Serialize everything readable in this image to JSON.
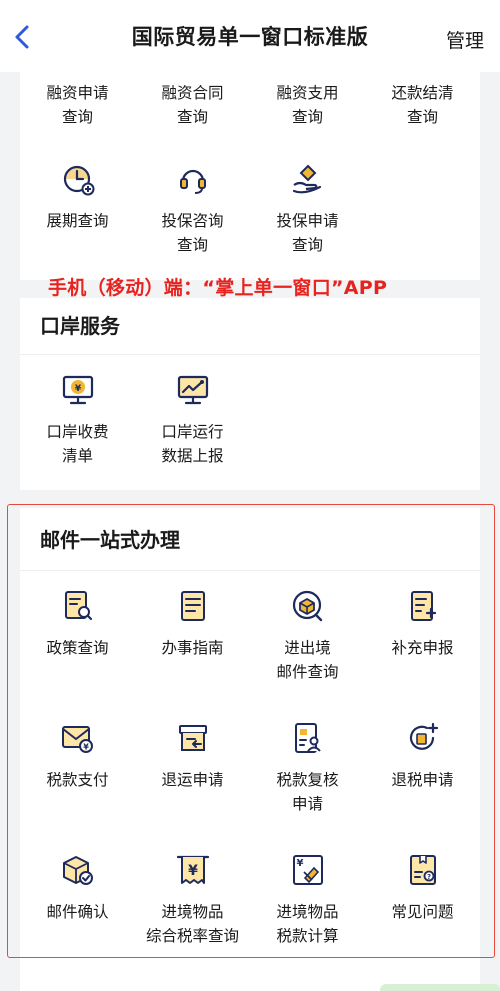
{
  "nav": {
    "title": "国际贸易单一窗口标准版",
    "manage_label": "管理"
  },
  "annotation": "手机（移动）端：“掌上单一窗口”APP",
  "finance": {
    "items": [
      {
        "label": "融资申请\n查询"
      },
      {
        "label": "融资合同\n查询"
      },
      {
        "label": "融资支用\n查询"
      },
      {
        "label": "还款结清\n查询"
      },
      {
        "label": "展期查询",
        "icon": "clock-plus-icon"
      },
      {
        "label": "投保咨询\n查询",
        "icon": "headset-icon"
      },
      {
        "label": "投保申请\n查询",
        "icon": "hand-diamond-icon"
      }
    ]
  },
  "port": {
    "title": "口岸服务",
    "items": [
      {
        "label": "口岸收费\n清单",
        "icon": "yuan-monitor-icon"
      },
      {
        "label": "口岸运行\n数据上报",
        "icon": "trend-monitor-icon"
      }
    ]
  },
  "mail": {
    "title": "邮件一站式办理",
    "items": [
      {
        "label": "政策查询",
        "icon": "document-search-icon"
      },
      {
        "label": "办事指南",
        "icon": "guide-document-icon"
      },
      {
        "label": "进出境\n邮件查询",
        "icon": "package-search-icon"
      },
      {
        "label": "补充申报",
        "icon": "document-add-icon"
      },
      {
        "label": "税款支付",
        "icon": "envelope-yuan-icon"
      },
      {
        "label": "退运申请",
        "icon": "return-box-icon"
      },
      {
        "label": "税款复核\n申请",
        "icon": "document-user-icon"
      },
      {
        "label": "退税申请",
        "icon": "tax-refund-icon"
      },
      {
        "label": "邮件确认",
        "icon": "package-check-icon"
      },
      {
        "label": "进境物品\n综合税率查询",
        "icon": "receipt-yuan-icon"
      },
      {
        "label": "进境物品\n税款计算",
        "icon": "yuan-calculator-icon"
      },
      {
        "label": "常见问题",
        "icon": "faq-box-icon"
      }
    ]
  },
  "colors": {
    "navy": "#1f2a5c",
    "gold": "#f2b632",
    "accent_blue": "#2e5bd8",
    "annotation_red": "#e8231f"
  }
}
